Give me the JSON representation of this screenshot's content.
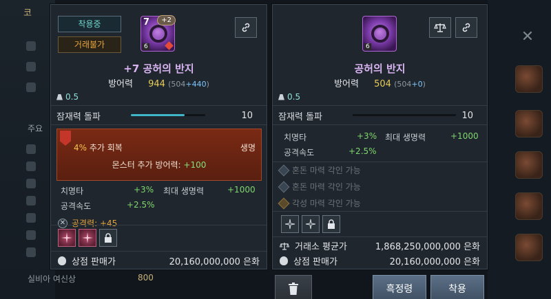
{
  "background": {
    "left_title": "코",
    "left_label": "주요",
    "bottom_name": "실비아 여신상",
    "bottom_value": "800"
  },
  "left_panel": {
    "badge_equipped": "착용중",
    "badge_untradable": "거래불가",
    "icon_level": "7",
    "icon_bonus": "+2",
    "icon_tier": "6",
    "item_name": "+7 공허의 반지",
    "defense_label": "방어력",
    "defense_value": "944",
    "defense_detail": "(504",
    "defense_plus": "+440",
    "defense_close": ")",
    "weight": "0.5",
    "potential_label": "잠재력 돌파",
    "potential_value": "10",
    "potential_fill": 0.72,
    "effect_line1_hl": "4%",
    "effect_line1": " 추가 회복",
    "effect_right": "생명",
    "effect_line2": "몬스터 추가 방어력: ",
    "effect_line2_val": "+100",
    "stats": [
      {
        "label": "치명타",
        "value": "+3%"
      },
      {
        "label": "최대 생명력",
        "value": "+1000"
      },
      {
        "label": "공격속도",
        "value": "+2.5%"
      }
    ],
    "attack_label": "공격력: +45",
    "price_label": "상점 판매가",
    "price_value": "20,160,000,000 은화"
  },
  "right_panel": {
    "icon_tier": "6",
    "item_name": "공허의 반지",
    "defense_label": "방어력",
    "defense_value": "504",
    "defense_detail": "(504",
    "defense_plus": "+0",
    "defense_close": ")",
    "weight": "0.5",
    "potential_label": "잠재력 돌파",
    "potential_value": "10",
    "stats": [
      {
        "label": "치명타",
        "value": "+3%"
      },
      {
        "label": "최대 생명력",
        "value": "+1000"
      },
      {
        "label": "공격속도",
        "value": "+2.5%"
      }
    ],
    "engravings": [
      {
        "label": "혼돈 마력 각인 가능",
        "type": "chaos"
      },
      {
        "label": "혼돈 마력 각인 가능",
        "type": "chaos"
      },
      {
        "label": "각성 마력 각인 가능",
        "type": "awaken"
      }
    ],
    "market_label": "거래소 평균가",
    "market_value": "1,868,250,000,000 은화",
    "price_label": "상점 판매가",
    "price_value": "20,160,000,000 은화"
  },
  "buttons": {
    "enhance": "흑정령",
    "equip": "착용"
  },
  "colors": {
    "panel_bg": "#20262d",
    "name_purple": "#d8b4f2",
    "defense_gold": "#e8cd5a",
    "stat_green": "#7fd86f",
    "equipped_teal": "#6fd3c9",
    "untradable_orange": "#e6a53a"
  }
}
